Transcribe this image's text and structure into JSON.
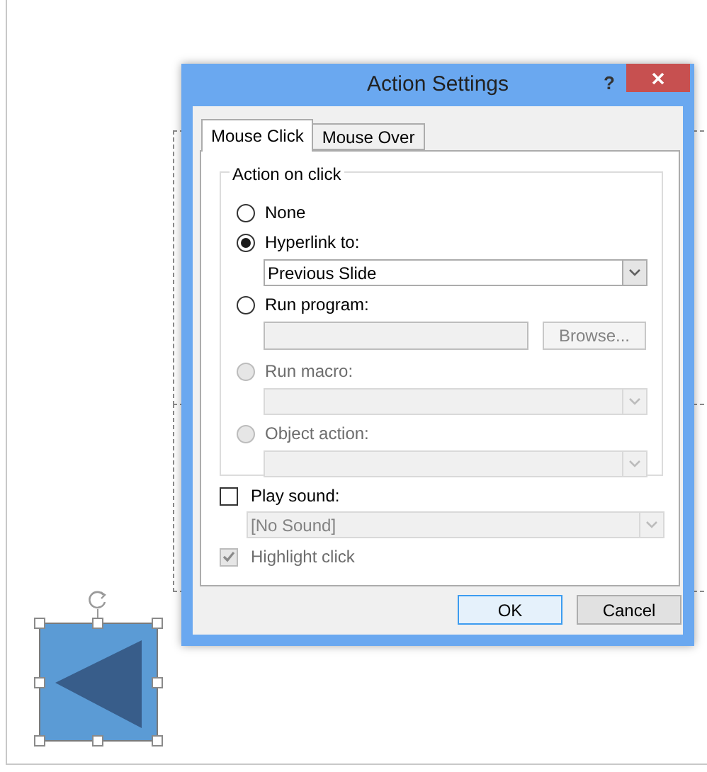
{
  "dialog": {
    "title": "Action Settings",
    "help": "?",
    "tabs": [
      {
        "label": "Mouse Click",
        "selected": true
      },
      {
        "label": "Mouse Over",
        "selected": false
      }
    ],
    "group": {
      "title": "Action on click",
      "options": [
        {
          "label": "None",
          "selected": false,
          "disabled": false
        },
        {
          "label": "Hyperlink to:",
          "selected": true,
          "disabled": false,
          "combo": {
            "value": "Previous Slide",
            "disabled": false
          }
        },
        {
          "label": "Run program:",
          "selected": false,
          "disabled": false,
          "field": {
            "disabled": true
          },
          "button": {
            "label": "Browse...",
            "disabled": true
          }
        },
        {
          "label": "Run macro:",
          "selected": false,
          "disabled": true,
          "combo": {
            "disabled": true
          }
        },
        {
          "label": "Object action:",
          "selected": false,
          "disabled": true,
          "combo": {
            "disabled": true
          }
        }
      ]
    },
    "play_sound": {
      "label": "Play sound:",
      "checked": false,
      "disabled": false,
      "combo": {
        "value": "[No Sound]",
        "disabled": true
      }
    },
    "highlight_click": {
      "label": "Highlight click",
      "checked": true,
      "disabled": true
    },
    "buttons": [
      {
        "label": "OK",
        "default": true
      },
      {
        "label": "Cancel",
        "default": false
      }
    ]
  }
}
